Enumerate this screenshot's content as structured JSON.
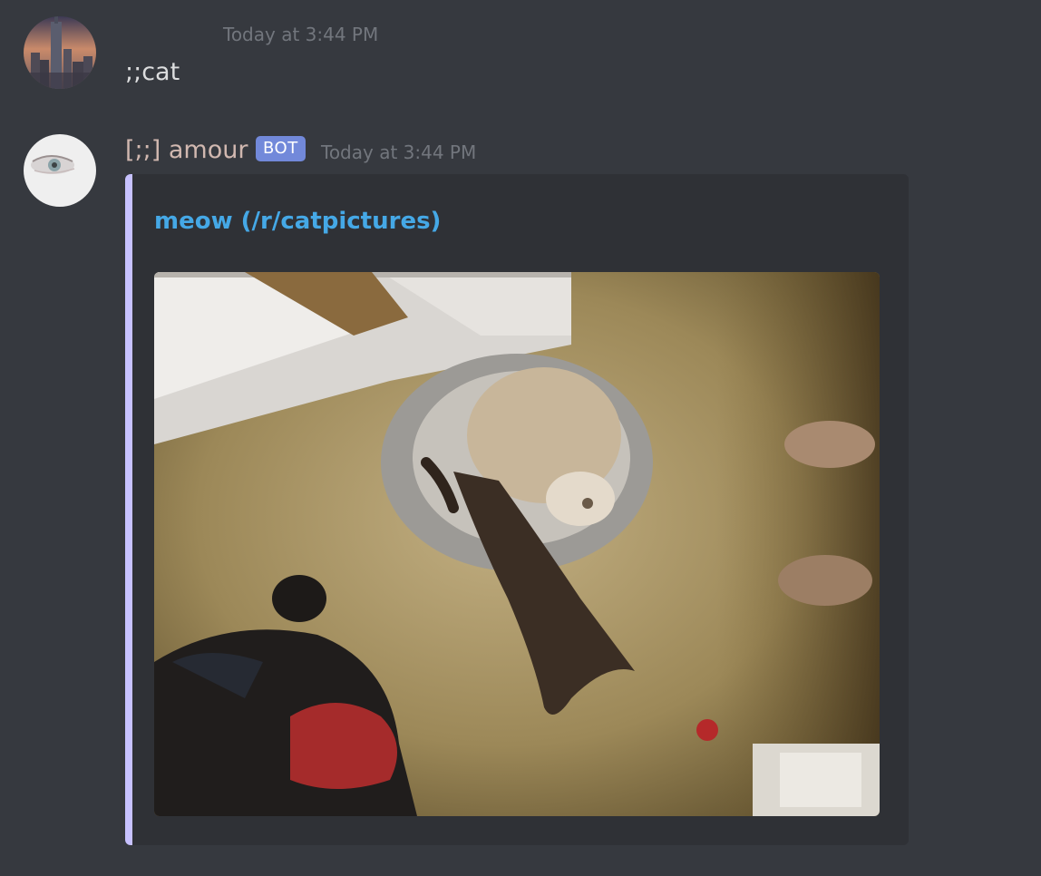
{
  "messages": [
    {
      "author_avatar": "city-skyline-avatar",
      "timestamp": "Today at 3:44 PM",
      "content": ";;cat"
    },
    {
      "author_avatar": "eye-avatar",
      "author": "[;;] amour",
      "bot_tag": "BOT",
      "timestamp": "Today at 3:44 PM",
      "embed": {
        "title": "meow (/r/catpictures)",
        "accent_color": "#c7c1ff",
        "title_color": "#45a8e6",
        "image": "cat-photo"
      }
    }
  ],
  "colors": {
    "background": "#36393f",
    "embed_background": "#2f3136",
    "bot_tag": "#7289da",
    "username": "#d1b8b0"
  }
}
